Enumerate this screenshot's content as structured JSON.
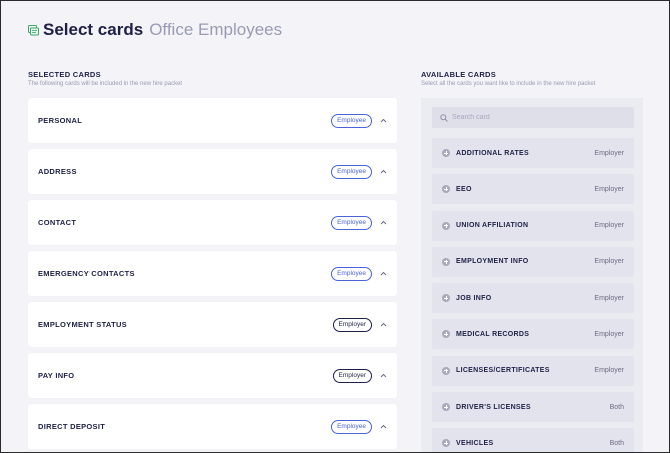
{
  "header": {
    "title": "Select cards",
    "subtitle": "Office Employees"
  },
  "selected": {
    "title": "SELECTED CARDS",
    "description": "The following cards will be included in the new hire packet",
    "cards": [
      {
        "label": "PERSONAL",
        "badge": "Employee",
        "badge_style": "blue"
      },
      {
        "label": "ADDRESS",
        "badge": "Employee",
        "badge_style": "blue"
      },
      {
        "label": "CONTACT",
        "badge": "Employee",
        "badge_style": "blue"
      },
      {
        "label": "EMERGENCY CONTACTS",
        "badge": "Employee",
        "badge_style": "blue"
      },
      {
        "label": "EMPLOYMENT STATUS",
        "badge": "Employer",
        "badge_style": "dark"
      },
      {
        "label": "PAY INFO",
        "badge": "Employer",
        "badge_style": "dark"
      },
      {
        "label": "DIRECT DEPOSIT",
        "badge": "Employee",
        "badge_style": "blue"
      }
    ]
  },
  "available": {
    "title": "AVAILABLE CARDS",
    "description": "Select all the cards you want like to include in the new hire packet",
    "search_placeholder": "Search card",
    "cards": [
      {
        "label": "ADDITIONAL RATES",
        "type": "Employer"
      },
      {
        "label": "EEO",
        "type": "Employer"
      },
      {
        "label": "UNION AFFILIATION",
        "type": "Employer"
      },
      {
        "label": "EMPLOYMENT INFO",
        "type": "Employer"
      },
      {
        "label": "JOB INFO",
        "type": "Employer"
      },
      {
        "label": "MEDICAL RECORDS",
        "type": "Employer"
      },
      {
        "label": "LICENSES/CERTIFICATES",
        "type": "Employer"
      },
      {
        "label": "DRIVER'S LICENSES",
        "type": "Both"
      },
      {
        "label": "VEHICLES",
        "type": "Both"
      }
    ]
  },
  "colors": {
    "accent": "#4a63d9",
    "title": "#1e2047",
    "muted": "#9a9bb3",
    "icon_green": "#3fa86b"
  }
}
